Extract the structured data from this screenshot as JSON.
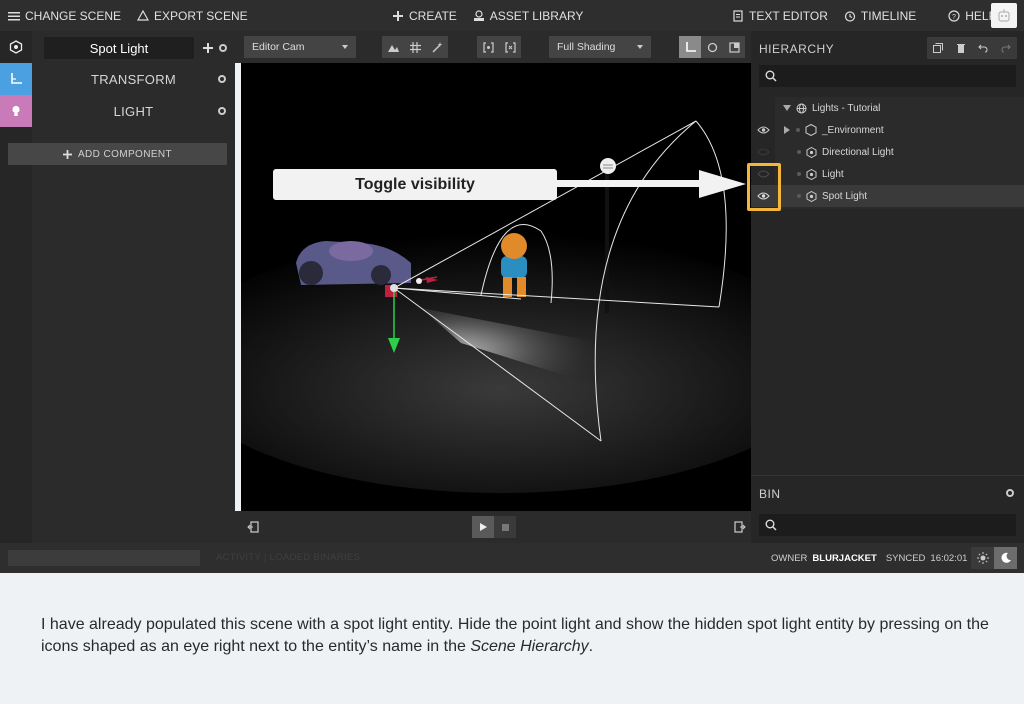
{
  "topbar": {
    "change_scene": "CHANGE SCENE",
    "export_scene": "EXPORT SCENE",
    "create": "CREATE",
    "asset_library": "ASSET LIBRARY",
    "text_editor": "TEXT EDITOR",
    "timeline": "TIMELINE",
    "help": "HELP"
  },
  "inspector": {
    "entity_name": "Spot Light",
    "components": [
      "TRANSFORM",
      "LIGHT"
    ],
    "add_component": "ADD COMPONENT"
  },
  "viewport_toolbar": {
    "camera": "Editor Cam",
    "shading": "Full Shading"
  },
  "hierarchy": {
    "title": "HIERARCHY",
    "items": [
      {
        "label": "Lights - Tutorial",
        "icon": "globe-icon"
      },
      {
        "label": "_Environment",
        "icon": "hexagon-icon"
      },
      {
        "label": "Directional Light",
        "icon": "entity-icon"
      },
      {
        "label": "Light",
        "icon": "entity-icon"
      },
      {
        "label": "Spot Light",
        "icon": "entity-icon"
      }
    ]
  },
  "bin": {
    "title": "BIN"
  },
  "status": {
    "faded": "ACTIVITY | LOADED BINARIES",
    "owner_label": "OWNER",
    "owner": "BLURJACKET",
    "synced_label": "SYNCED",
    "synced_time": "16:02:01"
  },
  "callout": {
    "text": "Toggle visibility"
  },
  "instructions": {
    "part1": "I have already populated this scene with a spot light entity. Hide the point light and show the hidden spot light entity by pressing on the icons shaped as an eye right next to the entity’s name in the ",
    "emph": "Scene Hierarchy",
    "part2": "."
  },
  "colors": {
    "transform_accent": "#4aa0e0",
    "light_accent": "#c97ab8",
    "highlight": "#f5b43a"
  }
}
